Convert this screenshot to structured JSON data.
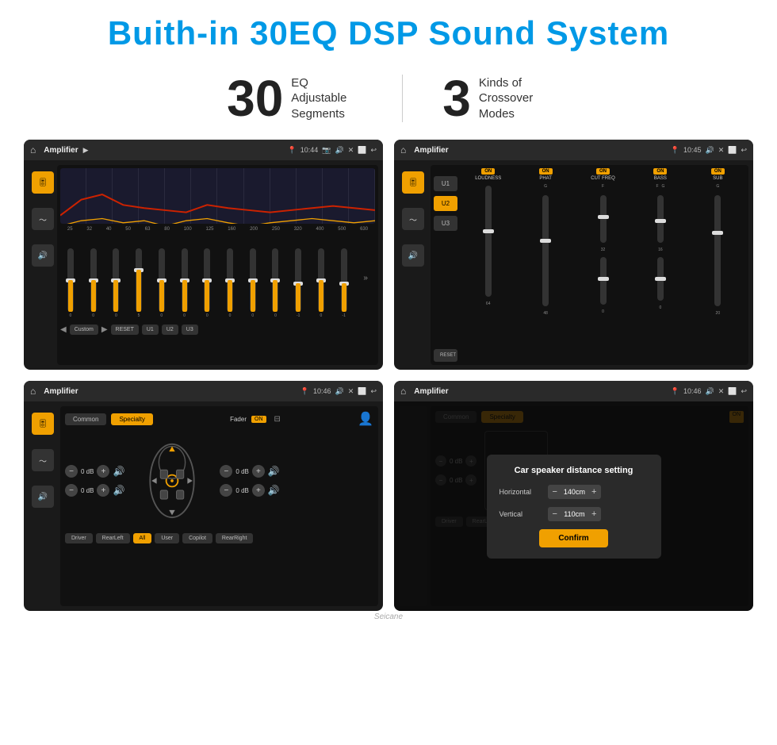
{
  "header": {
    "title": "Buith-in 30EQ DSP Sound System"
  },
  "stats": [
    {
      "number": "30",
      "label": "EQ Adjustable\nSegments"
    },
    {
      "number": "3",
      "label": "Kinds of\nCrossover Modes"
    }
  ],
  "screens": [
    {
      "id": "eq-amplifier",
      "topbar": {
        "title": "Amplifier",
        "time": "10:44"
      },
      "eq_labels": [
        "25",
        "32",
        "40",
        "50",
        "63",
        "80",
        "100",
        "125",
        "160",
        "200",
        "250",
        "320",
        "400",
        "500",
        "630"
      ],
      "eq_values": [
        "0",
        "0",
        "0",
        "5",
        "0",
        "0",
        "0",
        "0",
        "0",
        "0",
        "-1",
        "0",
        "-1"
      ],
      "buttons": [
        "Custom",
        "RESET",
        "U1",
        "U2",
        "U3"
      ]
    },
    {
      "id": "crossover",
      "topbar": {
        "title": "Amplifier",
        "time": "10:45"
      },
      "channels": [
        "LOUDNESS",
        "PHAT",
        "CUT FREQ",
        "BASS",
        "SUB"
      ],
      "u_buttons": [
        "U1",
        "U2",
        "U3"
      ],
      "reset": "RESET"
    },
    {
      "id": "specialty",
      "topbar": {
        "title": "Amplifier",
        "time": "10:46"
      },
      "tabs": [
        "Common",
        "Specialty"
      ],
      "fader": "Fader",
      "fader_on": "ON",
      "db_values": [
        "0 dB",
        "0 dB",
        "0 dB",
        "0 dB"
      ],
      "bottom_buttons": [
        "Driver",
        "RearLeft",
        "All",
        "User",
        "Copilot",
        "RearRight"
      ]
    },
    {
      "id": "dialog",
      "topbar": {
        "title": "Amplifier",
        "time": "10:46"
      },
      "dialog": {
        "title": "Car speaker distance setting",
        "fields": [
          {
            "label": "Horizontal",
            "value": "140cm"
          },
          {
            "label": "Vertical",
            "value": "110cm"
          }
        ],
        "confirm_label": "Confirm"
      }
    }
  ],
  "watermark": "Seicane"
}
